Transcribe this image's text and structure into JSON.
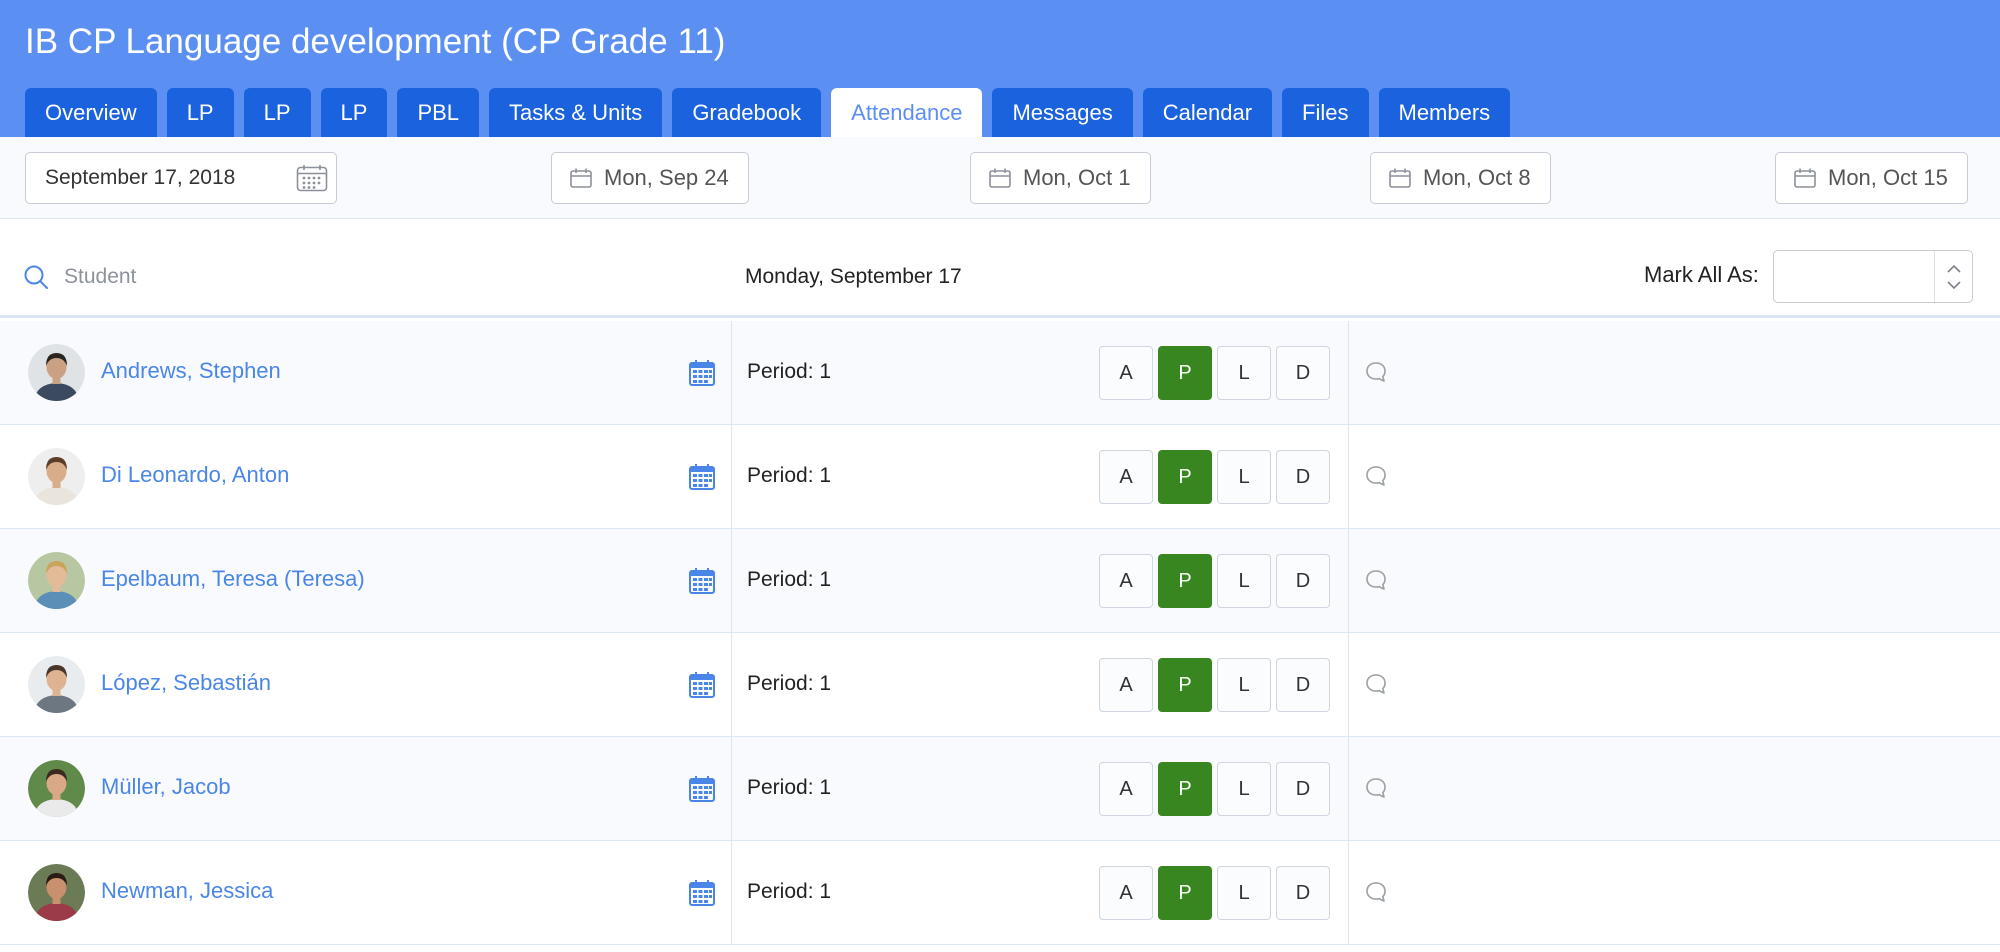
{
  "course": {
    "title": "IB CP Language development (CP Grade 11)"
  },
  "tabs": [
    {
      "label": "Overview",
      "active": false
    },
    {
      "label": "LP",
      "active": false
    },
    {
      "label": "LP",
      "active": false
    },
    {
      "label": "LP",
      "active": false
    },
    {
      "label": "PBL",
      "active": false
    },
    {
      "label": "Tasks & Units",
      "active": false
    },
    {
      "label": "Gradebook",
      "active": false
    },
    {
      "label": "Attendance",
      "active": true
    },
    {
      "label": "Messages",
      "active": false
    },
    {
      "label": "Calendar",
      "active": false
    },
    {
      "label": "Files",
      "active": false
    },
    {
      "label": "Members",
      "active": false
    }
  ],
  "datebar": {
    "current_date": "September 17, 2018",
    "current_date_icon": "calendar-grid-icon",
    "weeks": [
      "Mon, Sep 24",
      "Mon, Oct 1",
      "Mon, Oct 8",
      "Mon, Oct 15"
    ],
    "week_icon": "calendar-icon"
  },
  "filter": {
    "search_placeholder": "Student",
    "search_value": "",
    "search_icon": "search-icon",
    "day_label": "Monday, September 17",
    "mark_all_label": "Mark All As:",
    "mark_all_value": ""
  },
  "attendance_codes": [
    "A",
    "P",
    "L",
    "D"
  ],
  "students": [
    {
      "name": "Andrews, Stephen",
      "period": "Period: 1",
      "status": "P"
    },
    {
      "name": "Di Leonardo, Anton",
      "period": "Period: 1",
      "status": "P"
    },
    {
      "name": "Epelbaum, Teresa (Teresa)",
      "period": "Period: 1",
      "status": "P"
    },
    {
      "name": "López, Sebastián",
      "period": "Period: 1",
      "status": "P"
    },
    {
      "name": "Müller, Jacob",
      "period": "Period: 1",
      "status": "P"
    },
    {
      "name": "Newman, Jessica",
      "period": "Period: 1",
      "status": "P"
    }
  ],
  "colors": {
    "header": "#5b8ff2",
    "tab": "#1a62de",
    "tab_active_text": "#5b8ff2",
    "link": "#4a86e8",
    "present": "#38861f"
  }
}
